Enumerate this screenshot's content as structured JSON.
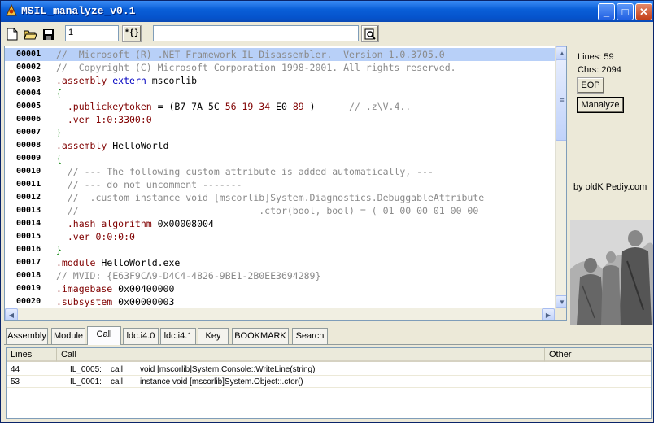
{
  "window": {
    "title": "MSIL_manalyze_v0.1"
  },
  "toolbar": {
    "line_number_value": "1",
    "goto_button_label": "*{}",
    "search_value": "",
    "icons": [
      "new-file-icon",
      "open-folder-icon",
      "save-icon",
      "search-icon"
    ]
  },
  "editor": {
    "lines": [
      {
        "num": "00001",
        "segments": [
          {
            "t": "//  Microsoft (R) .NET Framework IL Disassembler.  Version 1.0.3705.0",
            "c": "#8a8a8a"
          }
        ]
      },
      {
        "num": "00002",
        "segments": [
          {
            "t": "//  Copyright (C) Microsoft Corporation 1998-2001. All rights reserved.",
            "c": "#8a8a8a"
          }
        ]
      },
      {
        "num": "00003",
        "segments": [
          {
            "t": ".assembly ",
            "c": "#800000"
          },
          {
            "t": "extern ",
            "c": "#0000c0"
          },
          {
            "t": "mscorlib",
            "c": "#000000"
          }
        ]
      },
      {
        "num": "00004",
        "segments": [
          {
            "t": "{",
            "c": "#008000"
          }
        ]
      },
      {
        "num": "00005",
        "segments": [
          {
            "t": "  .publickeytoken",
            "c": "#800000"
          },
          {
            "t": " = (",
            "c": "#000000"
          },
          {
            "t": "B7 7A 5C ",
            "c": "#000000"
          },
          {
            "t": "56 19 34",
            "c": "#800000"
          },
          {
            "t": " E0 ",
            "c": "#000000"
          },
          {
            "t": "89",
            "c": "#800000"
          },
          {
            "t": " )      ",
            "c": "#000000"
          },
          {
            "t": "// .z\\V.4..",
            "c": "#8a8a8a"
          }
        ]
      },
      {
        "num": "00006",
        "segments": [
          {
            "t": "  .ver ",
            "c": "#800000"
          },
          {
            "t": "1:0:3300:0",
            "c": "#800000"
          }
        ]
      },
      {
        "num": "00007",
        "segments": [
          {
            "t": "}",
            "c": "#008000"
          }
        ]
      },
      {
        "num": "00008",
        "segments": [
          {
            "t": ".assembly ",
            "c": "#800000"
          },
          {
            "t": "HelloWorld",
            "c": "#000000"
          }
        ]
      },
      {
        "num": "00009",
        "segments": [
          {
            "t": "{",
            "c": "#008000"
          }
        ]
      },
      {
        "num": "00010",
        "segments": [
          {
            "t": "  // --- The following custom attribute is added automatically, ---",
            "c": "#8a8a8a"
          }
        ]
      },
      {
        "num": "00011",
        "segments": [
          {
            "t": "  // --- do not uncomment -------",
            "c": "#8a8a8a"
          }
        ]
      },
      {
        "num": "00012",
        "segments": [
          {
            "t": "  //  .custom instance void [mscorlib]System.Diagnostics.DebuggableAttribute",
            "c": "#8a8a8a"
          }
        ]
      },
      {
        "num": "00013",
        "segments": [
          {
            "t": "  //                                .ctor(bool, bool) = ( 01 00 00 01 00 00",
            "c": "#8a8a8a"
          }
        ]
      },
      {
        "num": "00014",
        "segments": [
          {
            "t": "  .hash ",
            "c": "#800000"
          },
          {
            "t": "algorithm ",
            "c": "#800000"
          },
          {
            "t": "0x00008004",
            "c": "#000000"
          }
        ]
      },
      {
        "num": "00015",
        "segments": [
          {
            "t": "  .ver ",
            "c": "#800000"
          },
          {
            "t": "0:0:0:0",
            "c": "#800000"
          }
        ]
      },
      {
        "num": "00016",
        "segments": [
          {
            "t": "}",
            "c": "#008000"
          }
        ]
      },
      {
        "num": "00017",
        "segments": [
          {
            "t": ".module ",
            "c": "#800000"
          },
          {
            "t": "HelloWorld.exe",
            "c": "#000000"
          }
        ]
      },
      {
        "num": "00018",
        "segments": [
          {
            "t": "// MVID: {E63F9CA9-D4C4-4826-9BE1-2B0EE3694289}",
            "c": "#8a8a8a"
          }
        ]
      },
      {
        "num": "00019",
        "segments": [
          {
            "t": ".imagebase ",
            "c": "#800000"
          },
          {
            "t": "0x00400000",
            "c": "#000000"
          }
        ]
      },
      {
        "num": "00020",
        "segments": [
          {
            "t": ".subsystem ",
            "c": "#800000"
          },
          {
            "t": "0x00000003",
            "c": "#000000"
          }
        ]
      }
    ]
  },
  "side": {
    "lines_label": "Lines: 59",
    "chrs_label": "Chrs: 2094",
    "eop_button": "EOP",
    "manalyze_button": "Manalyze",
    "credit": "by oldK Pediy.com"
  },
  "tabs": [
    {
      "label": "Assembly",
      "active": false
    },
    {
      "label": "Module",
      "active": false
    },
    {
      "label": "Call",
      "active": true
    },
    {
      "label": "ldc.i4.0",
      "active": false
    },
    {
      "label": "ldc.i4.1",
      "active": false
    },
    {
      "label": "Key",
      "active": false
    },
    {
      "label": "BOOKMARK",
      "active": false
    },
    {
      "label": "Search",
      "active": false
    }
  ],
  "results": {
    "columns": [
      "Lines",
      "Call",
      "Other"
    ],
    "rows": [
      {
        "line": "44",
        "addr": "IL_0005:",
        "op": "call",
        "target": "void [mscorlib]System.Console::WriteLine(string)",
        "other": ""
      },
      {
        "line": "53",
        "addr": "IL_0001:",
        "op": "call",
        "target": "instance void [mscorlib]System.Object::.ctor()",
        "other": ""
      }
    ]
  }
}
